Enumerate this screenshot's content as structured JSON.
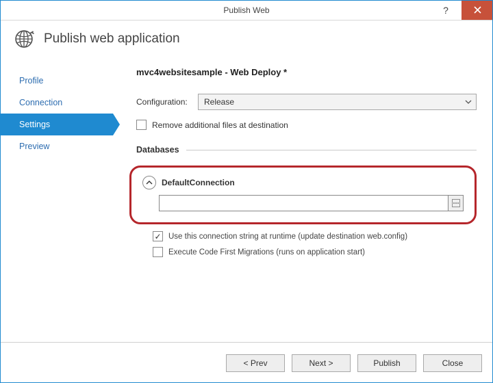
{
  "window": {
    "title": "Publish Web"
  },
  "header": {
    "title": "Publish web application"
  },
  "sidebar": {
    "items": [
      {
        "label": "Profile"
      },
      {
        "label": "Connection"
      },
      {
        "label": "Settings"
      },
      {
        "label": "Preview"
      }
    ]
  },
  "main": {
    "title": "mvc4websitesample - Web Deploy *",
    "config_label": "Configuration:",
    "config_value": "Release",
    "remove_files_label": "Remove additional files at destination",
    "databases_label": "Databases",
    "connection": {
      "name": "DefaultConnection",
      "value": "",
      "use_runtime_label": "Use this connection string at runtime (update destination web.config)",
      "use_runtime_checked": true,
      "code_first_label": "Execute Code First Migrations (runs on application start)",
      "code_first_checked": false
    }
  },
  "footer": {
    "prev": "< Prev",
    "next": "Next >",
    "publish": "Publish",
    "close": "Close"
  }
}
